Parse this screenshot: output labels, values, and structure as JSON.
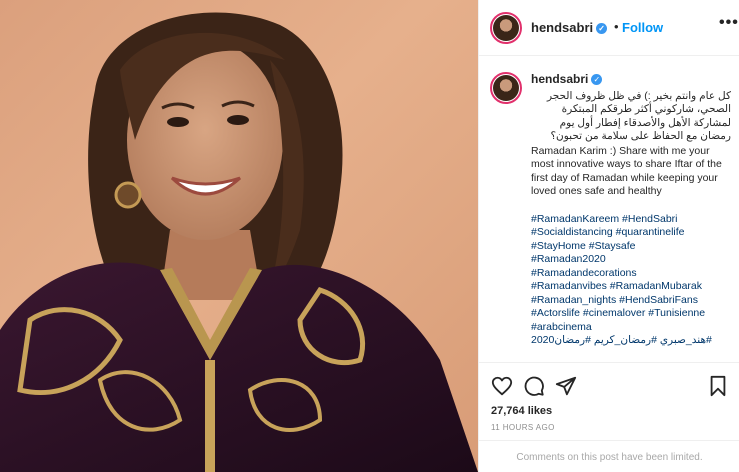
{
  "post": {
    "username": "hendsabri",
    "verified_icon": "verified-badge-icon",
    "follow_label": "Follow",
    "separator": "•",
    "more_label": "•••",
    "caption_arabic": "كل عام وانتم بخير :) في ظل ظروف الحجر الصحي، شاركوني أكثر طرقكم المبتكرة لمشاركة الأهل والأصدقاء إفطار أول يوم رمضان مع الحفاظ على سلامة من تحبون؟",
    "caption_english": "Ramadan Karim :) Share with me your most innovative ways to share Iftar of the first day of Ramadan while keeping your loved ones safe and healthy",
    "hashtags": [
      "#RamadanKareem #HendSabri",
      "#Socialdistancing #quarantinelife",
      "#StayHome #Staysafe",
      "#Ramadan2020",
      "#Ramadandecorations",
      "#Ramadanvibes #RamadanMubarak",
      "#Ramadan_nights #HendSabriFans",
      "#Actorslife #cinemalover #Tunisienne",
      "#arabcinema",
      "#هند_صبري #رمضان_كريم #رمضان2020"
    ],
    "likes": "27,764 likes",
    "timestamp": "11 HOURS AGO",
    "comments_notice": "Comments on this post have been limited.",
    "icons": [
      "heart-icon",
      "comment-icon",
      "share-icon",
      "bookmark-icon"
    ],
    "colors": {
      "link": "#00376b",
      "follow": "#0095f6",
      "muted": "#8e8e8e",
      "verified": "#3897f0"
    }
  }
}
